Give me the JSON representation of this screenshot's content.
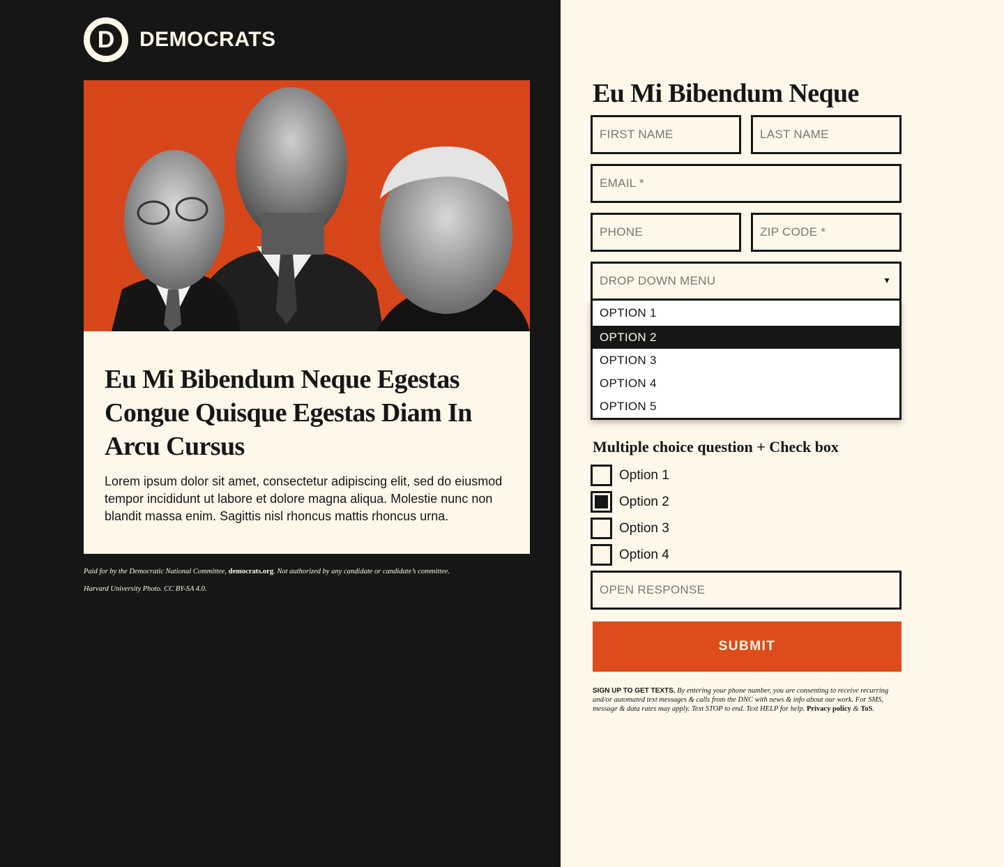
{
  "brand": {
    "logo_letter": "D",
    "name": "DEMOCRATS"
  },
  "card": {
    "title": "Eu Mi Bibendum Neque Egestas Congue Quisque Egestas Diam In Arcu Cursus",
    "body": "Lorem ipsum dolor sit amet, consectetur adipiscing elit, sed do eiusmod tempor incididunt ut labore et dolore magna aliqua. Molestie nunc non blandit massa enim. Sagittis nisl rhoncus mattis rhoncus urna."
  },
  "disclaimer": {
    "prefix": "Paid for by the Democratic National Committee, ",
    "link": "democrats.org",
    "suffix": ". Not authorized by any candidate or candidate’s committee.",
    "credit": "Harvard University Photo. CC BY-SA 4.0."
  },
  "form": {
    "title": "Eu Mi Bibendum Neque",
    "first_name_placeholder": "FIRST NAME",
    "last_name_placeholder": "LAST NAME",
    "email_placeholder": "EMAIL *",
    "phone_placeholder": "PHONE",
    "zip_placeholder": "ZIP CODE *",
    "dropdown": {
      "label": "DROP DOWN MENU",
      "arrow": "▼",
      "options": [
        "OPTION 1",
        "OPTION 2",
        "OPTION 3",
        "OPTION 4",
        "OPTION 5"
      ],
      "highlighted": "OPTION 2"
    },
    "mc_title": "Multiple choice question + Check box",
    "checkboxes": [
      {
        "label": "Option 1",
        "checked": false
      },
      {
        "label": "Option 2",
        "checked": true
      },
      {
        "label": "Option 3",
        "checked": false
      },
      {
        "label": "Option 4",
        "checked": false
      }
    ],
    "open_response_placeholder": "OPEN RESPONSE",
    "submit_label": "SUBMIT"
  },
  "sms": {
    "lead": "SIGN UP TO GET TEXTS.",
    "text": " By entering your phone number, you are consenting to receive recurring and/or automated text messages & calls from the DNC with news & info about our work. For SMS, message & data rates may apply. Text STOP to end. Text HELP for help.",
    "privacy": "Privacy policy",
    "amp": " & ",
    "tos": "ToS",
    "end": "."
  },
  "colors": {
    "dark": "#161616",
    "cream": "#fdf8e9",
    "accent": "#de4c1b"
  }
}
